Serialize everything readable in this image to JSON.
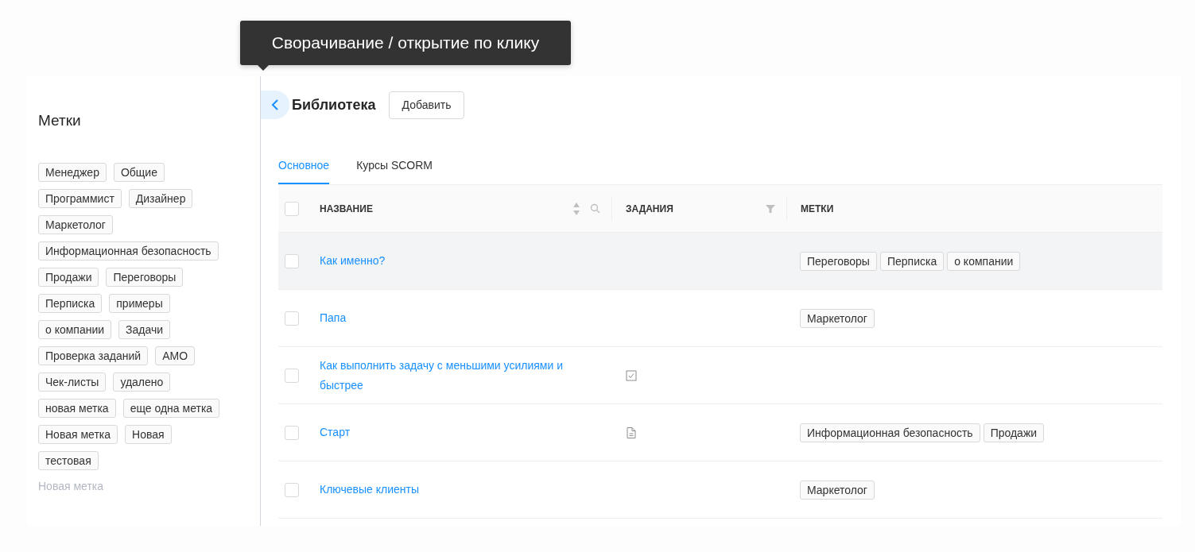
{
  "tooltip": {
    "text": "Сворачивание / открытие по клику"
  },
  "sidebar": {
    "title": "Метки",
    "tags": [
      "Менеджер",
      "Общие",
      "Программист",
      "Дизайнер",
      "Маркетолог",
      "Информационная безопасность",
      "Продажи",
      "Переговоры",
      "Перписка",
      "примеры",
      "о компании",
      "Задачи",
      "Проверка заданий",
      "АМО",
      "Чек-листы",
      "удалено",
      "новая метка",
      "еще одна метка",
      "Новая метка",
      "Новая",
      "тестовая"
    ],
    "new_tag": {
      "placeholder": "Новая метка"
    }
  },
  "header": {
    "title": "Библиотека",
    "add_button": "Добавить"
  },
  "tabs": [
    {
      "label": "Основное",
      "selected": true
    },
    {
      "label": "Курсы SCORM",
      "selected": false
    }
  ],
  "table": {
    "select_all": {
      "checked": false
    },
    "columns": [
      "НАЗВАНИЕ",
      "ЗАДАНИЯ",
      "МЕТКИ"
    ],
    "rows": [
      {
        "name": "Как именно?",
        "checked": false,
        "hovered": true,
        "tags": [
          "Переговоры",
          "Перписка",
          "о компании"
        ]
      },
      {
        "name": "Папа",
        "checked": false,
        "hovered": false,
        "tags": [
          "Маркетолог"
        ]
      },
      {
        "name": "Как выполнить задачу с меньшими усилиями и быстрее",
        "checked": false,
        "hovered": false,
        "task": {
          "kind": "test"
        },
        "tags": []
      },
      {
        "name": "Старт",
        "checked": false,
        "hovered": false,
        "task": {
          "kind": "document"
        },
        "tags": [
          "Информационная безопасность",
          "Продажи"
        ]
      },
      {
        "name": "Ключевые клиенты",
        "checked": false,
        "hovered": false,
        "tags": [
          "Маркетолог"
        ]
      }
    ]
  }
}
